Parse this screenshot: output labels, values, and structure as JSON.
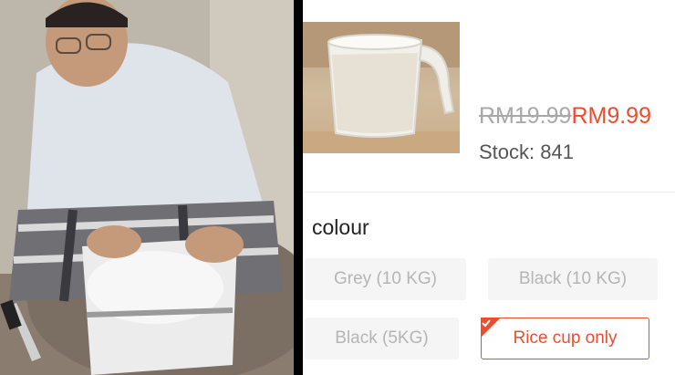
{
  "product": {
    "old_price": "RM19.99",
    "new_price": "RM9.99",
    "stock_label": "Stock: 841"
  },
  "variation": {
    "title": "colour",
    "options": [
      {
        "label": "Grey (10 KG)",
        "state": "disabled"
      },
      {
        "label": "Black (10 KG)",
        "state": "disabled"
      },
      {
        "label": "Black (5KG)",
        "state": "disabled"
      },
      {
        "label": "Rice cup only",
        "state": "selected"
      }
    ]
  },
  "colors": {
    "accent": "#ee4d2d",
    "muted_text": "#b5b5b5",
    "option_bg": "#f5f5f5"
  }
}
